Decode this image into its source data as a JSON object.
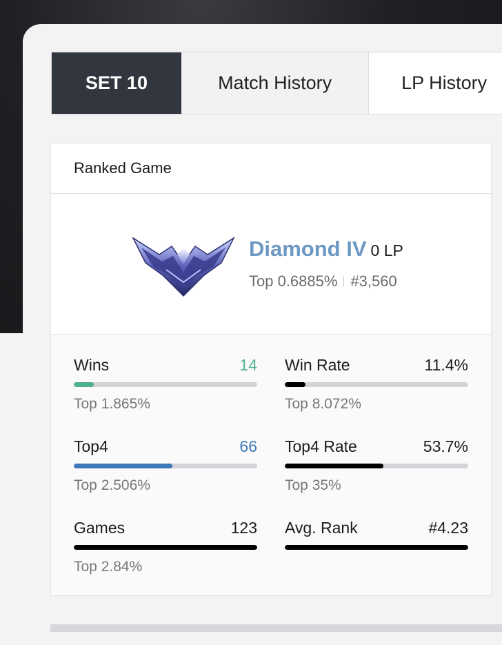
{
  "tabs": [
    {
      "label": "SET 10",
      "active": true
    },
    {
      "label": "Match History",
      "active": false
    },
    {
      "label": "LP History",
      "active": false
    }
  ],
  "card": {
    "header": "Ranked Game",
    "tier": "Diamond IV",
    "lp": "0 LP",
    "top_percent": "Top 0.6885%",
    "ladder_rank": "#3,560",
    "emblem_icon": "diamond-emblem-icon"
  },
  "stats": {
    "wins": {
      "label": "Wins",
      "value": "14",
      "fraction": 0.11,
      "sub": "Top 1.865%",
      "color": "#4eb08e"
    },
    "win_rate": {
      "label": "Win Rate",
      "value": "11.4%",
      "fraction": 0.114,
      "sub": "Top 8.072%",
      "color": "#000000"
    },
    "top4": {
      "label": "Top4",
      "value": "66",
      "fraction": 0.537,
      "sub": "Top 2.506%",
      "color": "#3c78b8"
    },
    "top4_rate": {
      "label": "Top4 Rate",
      "value": "53.7%",
      "fraction": 0.537,
      "sub": "Top 35%",
      "color": "#000000"
    },
    "games": {
      "label": "Games",
      "value": "123",
      "fraction": 1.0,
      "sub": "Top 2.84%",
      "color": "#000000"
    },
    "avg_rank": {
      "label": "Avg. Rank",
      "value": "#4.23",
      "fraction": 1.0,
      "sub": "",
      "color": "#000000"
    }
  }
}
